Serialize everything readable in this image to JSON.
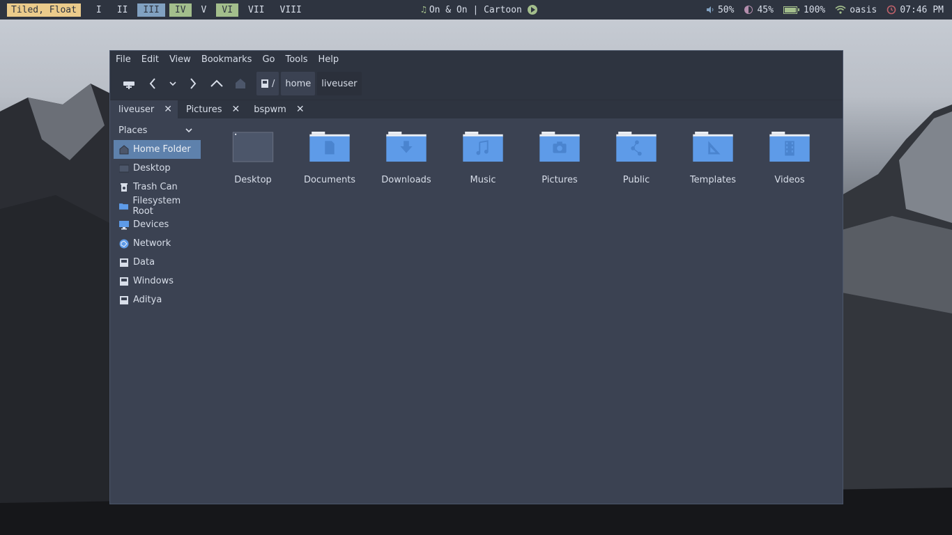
{
  "bar": {
    "layout": "Tiled, Float",
    "workspaces": [
      {
        "label": "I",
        "state": "empty"
      },
      {
        "label": "II",
        "state": "empty"
      },
      {
        "label": "III",
        "state": "focused"
      },
      {
        "label": "IV",
        "state": "occupied"
      },
      {
        "label": "V",
        "state": "empty"
      },
      {
        "label": "VI",
        "state": "occupied"
      },
      {
        "label": "VII",
        "state": "empty"
      },
      {
        "label": "VIII",
        "state": "empty"
      }
    ],
    "music": "On & On | Cartoon",
    "volume": "50%",
    "brightness": "45%",
    "battery": "100%",
    "wifi": "oasis",
    "clock": "07:46 PM",
    "colors": {
      "accent": "#81a1c1",
      "occupied": "#a3be8c",
      "layout": "#ebcb8b",
      "clock_icon": "#bf616a"
    }
  },
  "window": {
    "menu": [
      "File",
      "Edit",
      "View",
      "Bookmarks",
      "Go",
      "Tools",
      "Help"
    ],
    "path": {
      "root": "/",
      "segments": [
        "home",
        "liveuser"
      ]
    },
    "tabs": [
      {
        "label": "liveuser",
        "active": true
      },
      {
        "label": "Pictures",
        "active": false
      },
      {
        "label": "bspwm",
        "active": false
      }
    ],
    "sidebar": {
      "title": "Places",
      "items": [
        {
          "label": "Home Folder",
          "icon": "home-icon",
          "selected": true
        },
        {
          "label": "Desktop",
          "icon": "desktop-icon"
        },
        {
          "label": "Trash Can",
          "icon": "trash-icon"
        },
        {
          "label": "Filesystem Root",
          "icon": "folder-icon"
        },
        {
          "label": "Devices",
          "icon": "monitor-icon"
        },
        {
          "label": "Network",
          "icon": "network-icon"
        },
        {
          "label": "Data",
          "icon": "drive-icon"
        },
        {
          "label": "Windows",
          "icon": "drive-icon"
        },
        {
          "label": "Aditya",
          "icon": "drive-icon"
        }
      ]
    },
    "files": [
      {
        "label": "Desktop",
        "icon": "desktop-folder-icon"
      },
      {
        "label": "Documents",
        "icon": "documents-folder-icon"
      },
      {
        "label": "Downloads",
        "icon": "downloads-folder-icon"
      },
      {
        "label": "Music",
        "icon": "music-folder-icon"
      },
      {
        "label": "Pictures",
        "icon": "pictures-folder-icon"
      },
      {
        "label": "Public",
        "icon": "public-folder-icon"
      },
      {
        "label": "Templates",
        "icon": "templates-folder-icon"
      },
      {
        "label": "Videos",
        "icon": "videos-folder-icon"
      }
    ]
  }
}
